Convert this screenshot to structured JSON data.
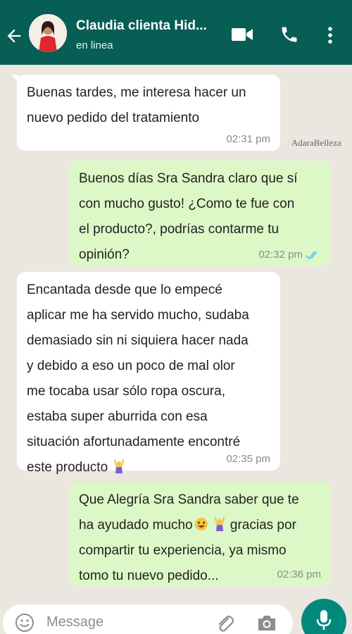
{
  "header": {
    "contact_name": "Claudia clienta Hid...",
    "status": "en linea",
    "color": "#075e54"
  },
  "watermark": {
    "brand": "AdaraBelleza"
  },
  "messages": [
    {
      "direction": "incoming",
      "text": "Buenas tardes, me interesa hacer un\nnuevo pedido del tratamiento",
      "time": "02:31 pm"
    },
    {
      "direction": "outgoing",
      "text": "Buenos días Sra Sandra claro que sí\ncon mucho gusto! ¿Como te fue con\nel producto?, podrías contarme tu\nopinión?",
      "time": "02:32 pm",
      "ticks": "read"
    },
    {
      "direction": "incoming",
      "text": "Encantada desde que lo empecé\naplicar me ha servido mucho, sudaba\ndemasiado sin ni siquiera hacer nada\ny debido a eso un poco de mal olor\nme tocaba usar sólo ropa oscura,\nestaba super aburrida con esa\nsituación afortunadamente encontré\neste producto",
      "time": "02:35 pm",
      "emoji": "person-raising-hands"
    },
    {
      "direction": "outgoing",
      "line1": "Que Alegría Sra Sandra saber que te",
      "line2_a": "ha ayudado mucho",
      "line2_b": "gracias por",
      "line3": "compartir tu experiencia, ya mismo\ntomo tu nuevo pedido...",
      "time": "02:36 pm",
      "emojis": [
        "grinning-face-tongue",
        "person-raising-hands"
      ]
    }
  ],
  "input": {
    "placeholder": "Message"
  },
  "colors": {
    "incoming": "#ffffff",
    "outgoing": "#dcf8c6",
    "accent": "#00897b",
    "read_ticks": "#4fc3f7"
  }
}
